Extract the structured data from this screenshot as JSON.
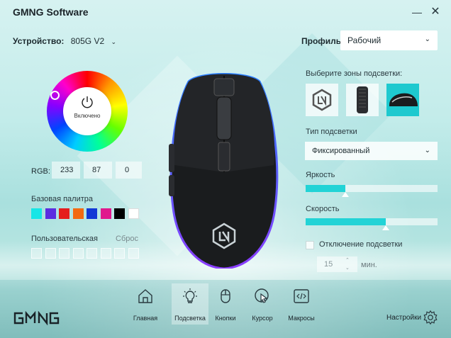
{
  "window": {
    "title": "GMNG Software",
    "minimize_icon": "minimize-icon",
    "close_icon": "close-icon"
  },
  "device": {
    "label": "Устройство:",
    "value": "805G V2"
  },
  "profile": {
    "label": "Профиль:",
    "value": "Рабочий"
  },
  "color_picker": {
    "power_label": "Включено",
    "rgb_label": "RGB:",
    "r": "233",
    "g": "87",
    "b": "0",
    "base_palette_label": "Базовая палитра",
    "base_palette": [
      "#16e6e6",
      "#5b2de0",
      "#e51d1d",
      "#f26a12",
      "#1238d6",
      "#e0188d",
      "#000000",
      "#ffffff"
    ],
    "custom_label": "Пользовательская",
    "reset_label": "Сброс"
  },
  "lighting": {
    "zones_label": "Выберите зоны подсветки:",
    "zones": [
      {
        "name": "logo-zone",
        "icon": "logo-icon"
      },
      {
        "name": "wheel-zone",
        "icon": "scroll-wheel-icon"
      },
      {
        "name": "side-zone",
        "icon": "mouse-side-icon",
        "active": true
      }
    ],
    "type_label": "Тип подсветки",
    "type_value": "Фиксированный",
    "brightness_label": "Яркость",
    "brightness_level": 0.3,
    "speed_label": "Скорость",
    "speed_level": 0.61,
    "off_label": "Отключение подсветки",
    "off_checked": false,
    "minutes_value": "15",
    "minutes_unit": "мин."
  },
  "nav": {
    "items": [
      {
        "label": "Главная",
        "icon": "home-icon"
      },
      {
        "label": "Подсветка",
        "icon": "lightbulb-icon",
        "active": true
      },
      {
        "label": "Кнопки",
        "icon": "mouse-buttons-icon"
      },
      {
        "label": "Курсор",
        "icon": "cursor-icon"
      },
      {
        "label": "Макросы",
        "icon": "code-icon"
      }
    ],
    "settings_label": "Настройки"
  },
  "colors": {
    "accent": "#22d3d6",
    "active_zone": "#1ec9cf"
  }
}
